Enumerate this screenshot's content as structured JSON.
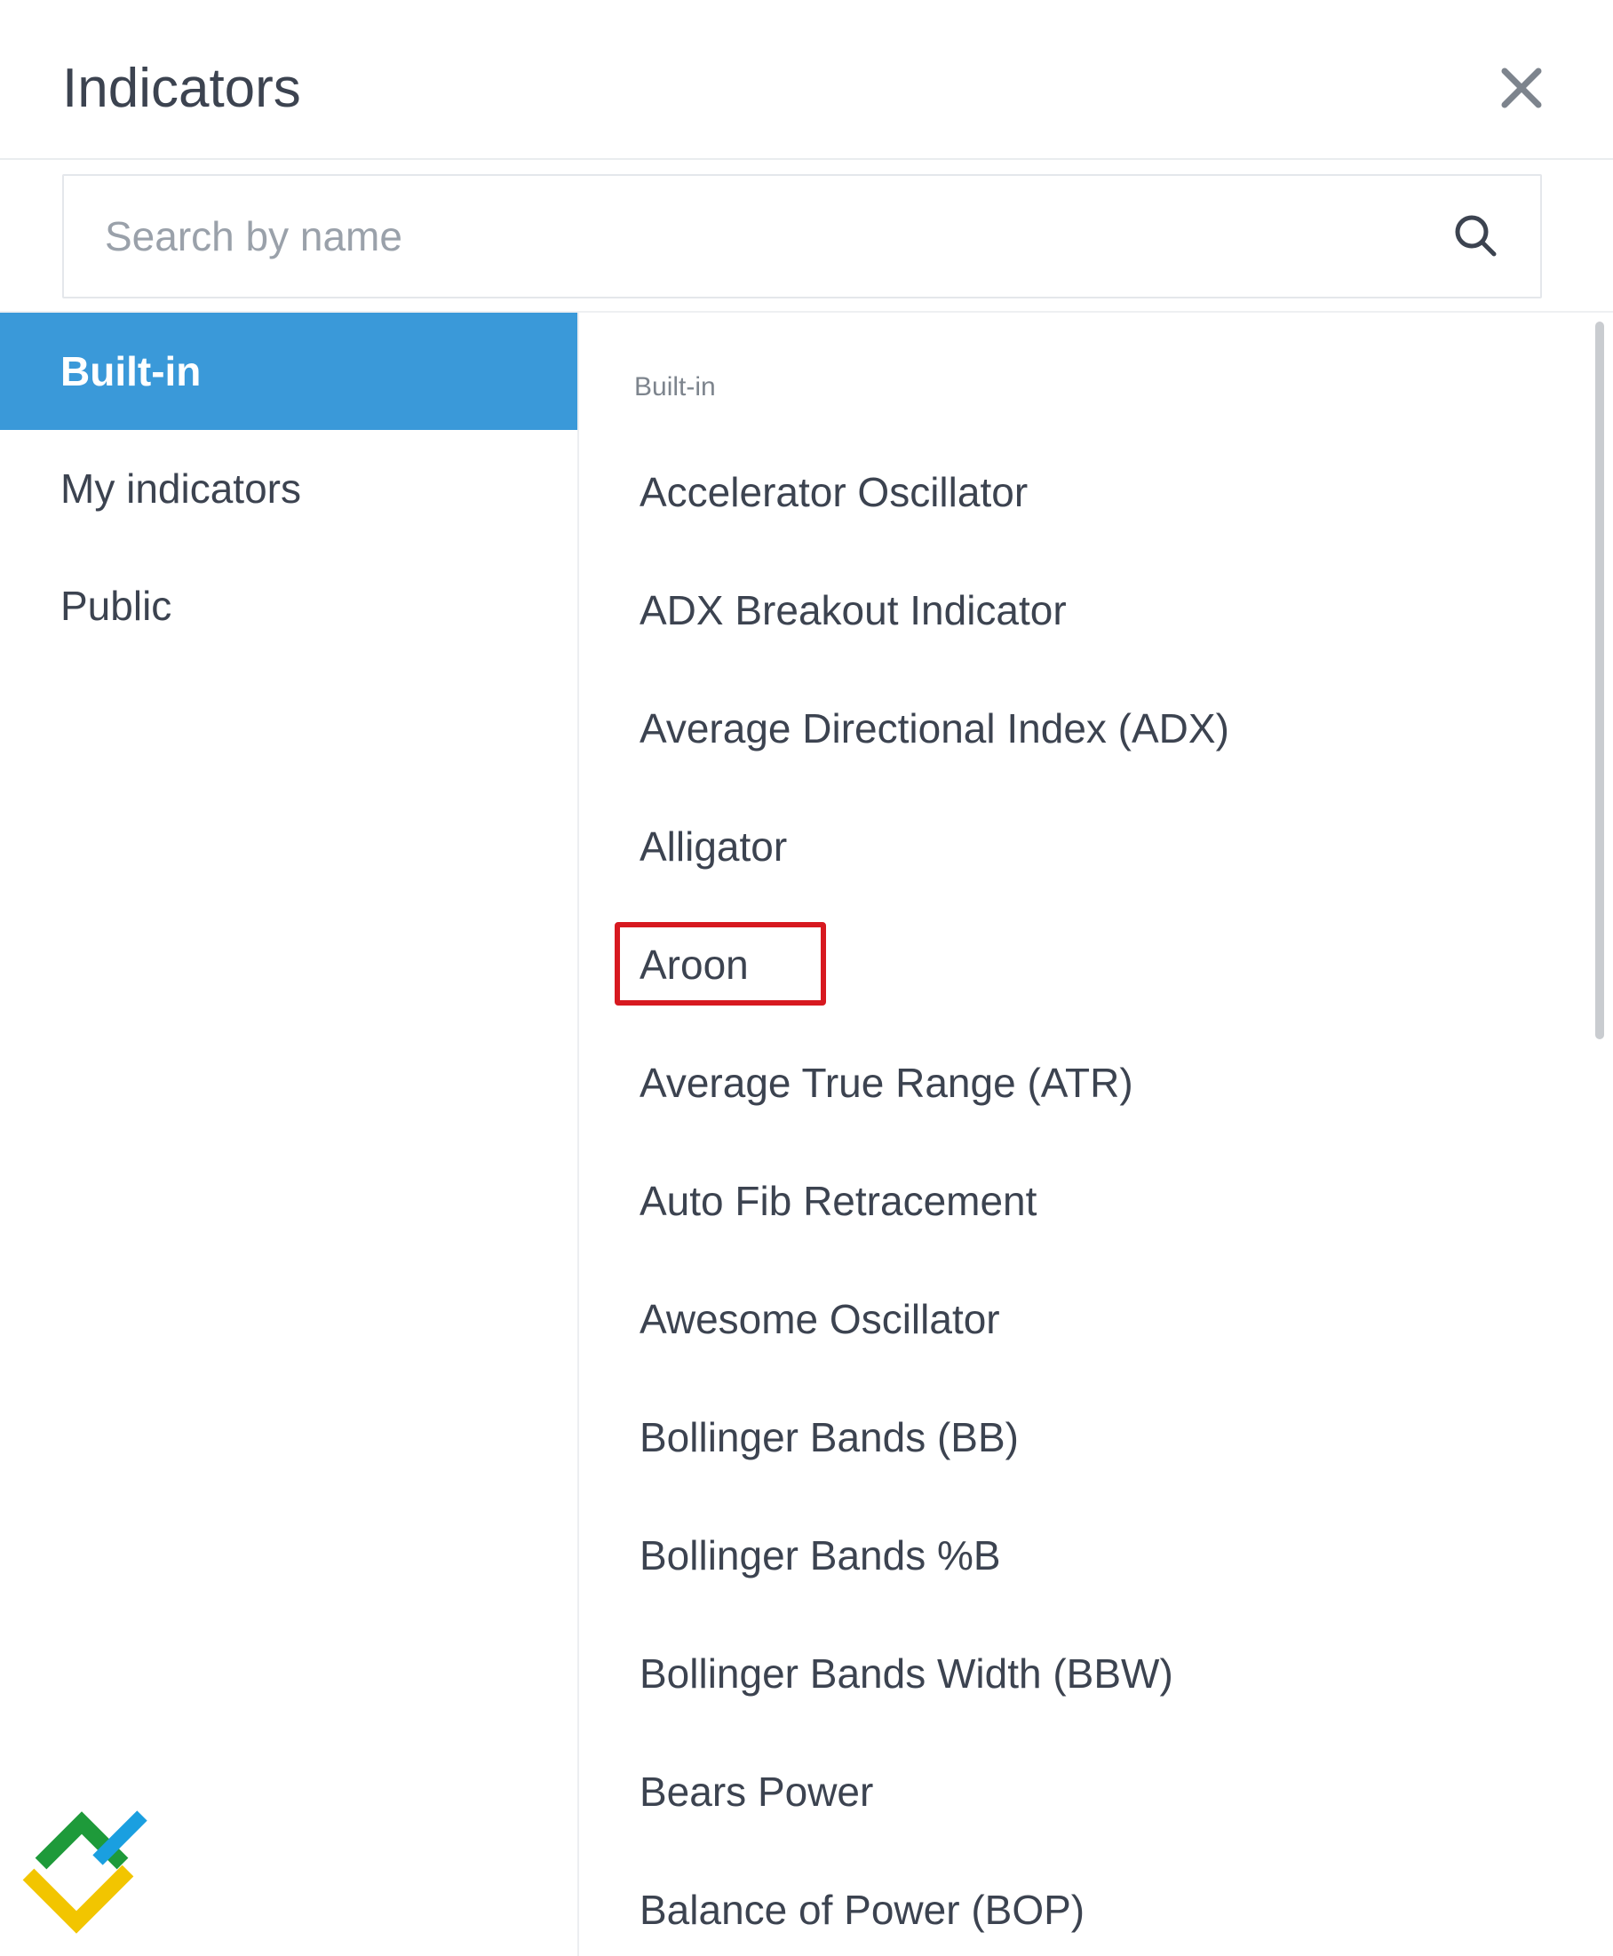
{
  "dialog": {
    "title": "Indicators",
    "close_icon": "close-icon"
  },
  "search": {
    "placeholder": "Search by name",
    "value": "",
    "icon": "search-icon"
  },
  "sidebar": {
    "items": [
      {
        "label": "Built-in",
        "active": true
      },
      {
        "label": "My indicators",
        "active": false
      },
      {
        "label": "Public",
        "active": false
      }
    ]
  },
  "main": {
    "section_label": "Built-in",
    "items": [
      {
        "label": "Accelerator Oscillator"
      },
      {
        "label": "ADX Breakout Indicator"
      },
      {
        "label": "Average Directional Index (ADX)"
      },
      {
        "label": "Alligator"
      },
      {
        "label": "Aroon",
        "highlighted": true
      },
      {
        "label": "Average True Range (ATR)"
      },
      {
        "label": "Auto Fib Retracement"
      },
      {
        "label": "Awesome Oscillator"
      },
      {
        "label": "Bollinger Bands (BB)"
      },
      {
        "label": "Bollinger Bands %B"
      },
      {
        "label": "Bollinger Bands Width (BBW)"
      },
      {
        "label": "Bears Power"
      },
      {
        "label": "Balance of Power (BOP)"
      }
    ]
  },
  "colors": {
    "accent": "#3a99d9",
    "highlight_border": "#d71920",
    "text": "#3c4350",
    "muted": "#7d848d",
    "logo_green": "#1e9a3a",
    "logo_blue": "#1a9fe0",
    "logo_yellow": "#f2c500"
  },
  "logo": {
    "icon": "brand-logo-icon"
  }
}
